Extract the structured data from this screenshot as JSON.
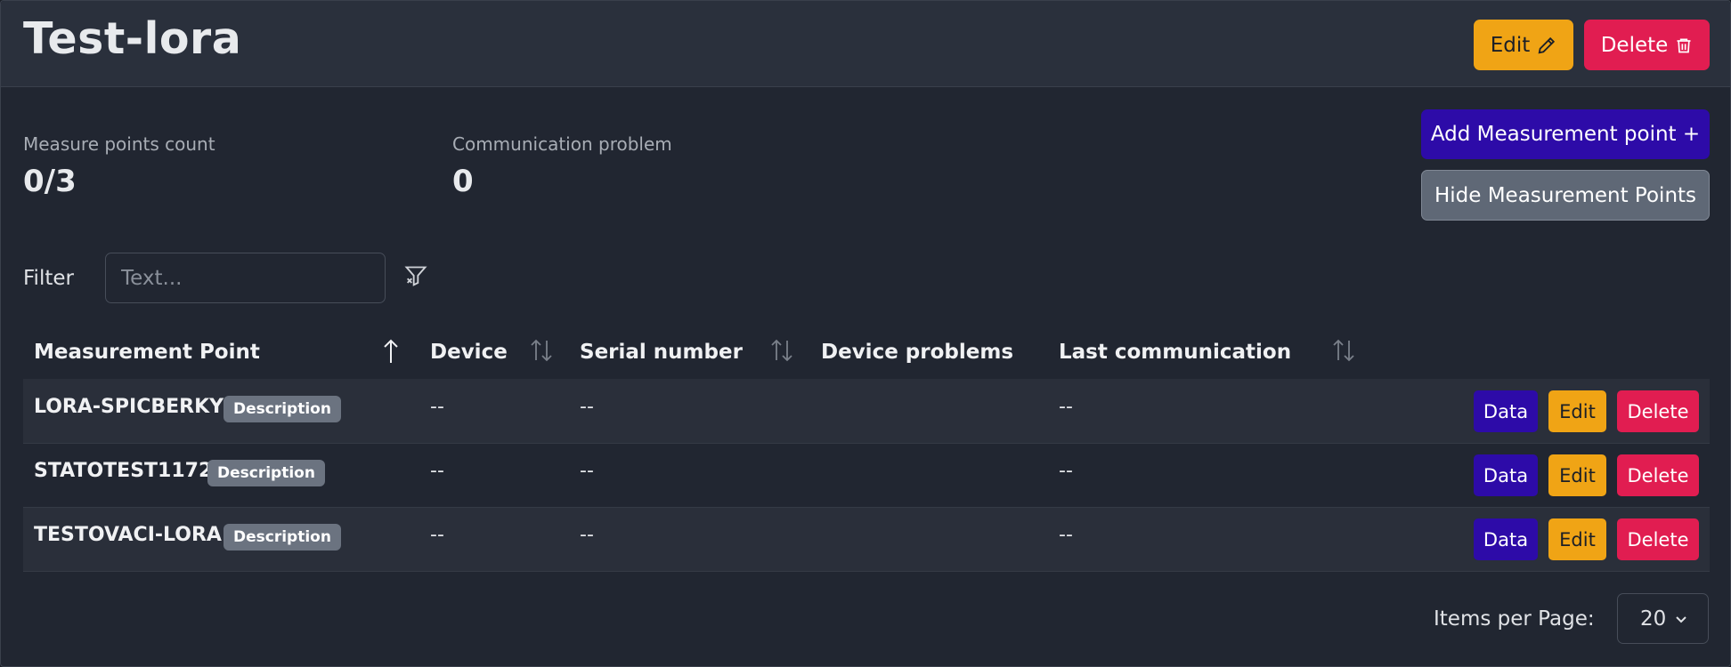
{
  "header": {
    "title": "Test-lora",
    "edit_label": "Edit",
    "delete_label": "Delete"
  },
  "stats": {
    "measure_points_count_label": "Measure points count",
    "measure_points_count_value": "0/3",
    "communication_problem_label": "Communication problem",
    "communication_problem_value": "0"
  },
  "actions": {
    "add_label": "Add Measurement point +",
    "hide_label": "Hide Measurement Points"
  },
  "filter": {
    "label": "Filter",
    "placeholder": "Text..."
  },
  "table": {
    "columns": [
      "Measurement Point",
      "Device",
      "Serial number",
      "Device problems",
      "Last communication"
    ],
    "rows": [
      {
        "name": "LORA-SPICBERKY",
        "badge": "Description",
        "device": "--",
        "serial": "--",
        "problems": "",
        "last": "--"
      },
      {
        "name": "STATOTEST1172",
        "badge": "Description",
        "device": "--",
        "serial": "--",
        "problems": "",
        "last": "--"
      },
      {
        "name": "TESTOVACI-LORA",
        "badge": "Description",
        "device": "--",
        "serial": "--",
        "problems": "",
        "last": "--"
      }
    ],
    "row_actions": {
      "data": "Data",
      "edit": "Edit",
      "delete": "Delete"
    }
  },
  "pagination": {
    "items_per_page_label": "Items per Page:",
    "items_per_page_value": "20"
  },
  "colors": {
    "warning": "#f0a415",
    "danger": "#e11d51",
    "primary": "#2d0ba8",
    "secondary": "#5f6876",
    "background": "#212631"
  }
}
